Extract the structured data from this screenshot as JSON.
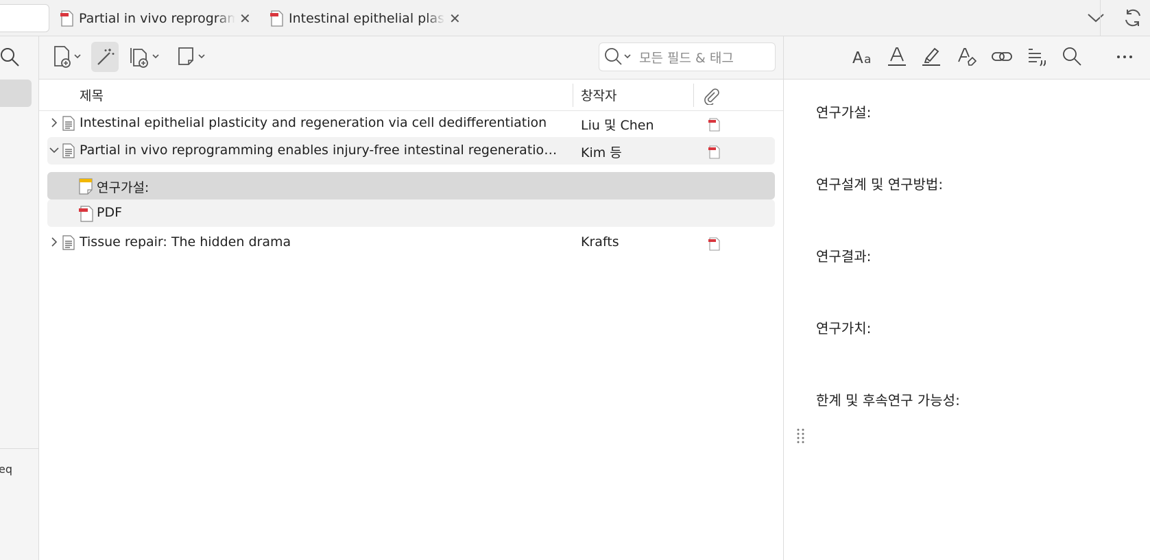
{
  "tabs": [
    {
      "label": "Partial in vivo reprogramming enables injury-free intestinal regeneration via autonomous",
      "icon": "pdf-icon"
    },
    {
      "label": "Intestinal epithelial plasticity and regeneration via cell dedifferentiation",
      "icon": "pdf-icon"
    }
  ],
  "collections": {
    "partial_label": "eq"
  },
  "toolbar": {
    "search_placeholder": "모든 필드 & 태그"
  },
  "columns": {
    "title": "제목",
    "creator": "창작자"
  },
  "rows": [
    {
      "title": "Intestinal epithelial plasticity and regeneration via cell dedifferentiation",
      "creator": "Liu 및 Chen",
      "expanded": false
    },
    {
      "title": "Partial in vivo reprogramming enables injury-free intestinal regeneration via autonomous",
      "creator": "Kim 등",
      "expanded": true
    },
    {
      "title": "연구가설:",
      "creator": "",
      "child": "note"
    },
    {
      "title": "PDF",
      "creator": "",
      "child": "pdf"
    },
    {
      "title": "Tissue repair: The hidden drama",
      "creator": "Krafts",
      "expanded": false
    }
  ],
  "note": {
    "lines": [
      "연구가설:",
      "연구설계 및 연구방법:",
      "연구결과:",
      "연구가치:",
      "한계 및 후속연구 가능성:"
    ]
  },
  "colors": {
    "selected_row": "#d9d9d9",
    "hover_row": "#f2f2f2",
    "pdf_red": "#d9363e",
    "note_yellow": "#f2b705"
  }
}
